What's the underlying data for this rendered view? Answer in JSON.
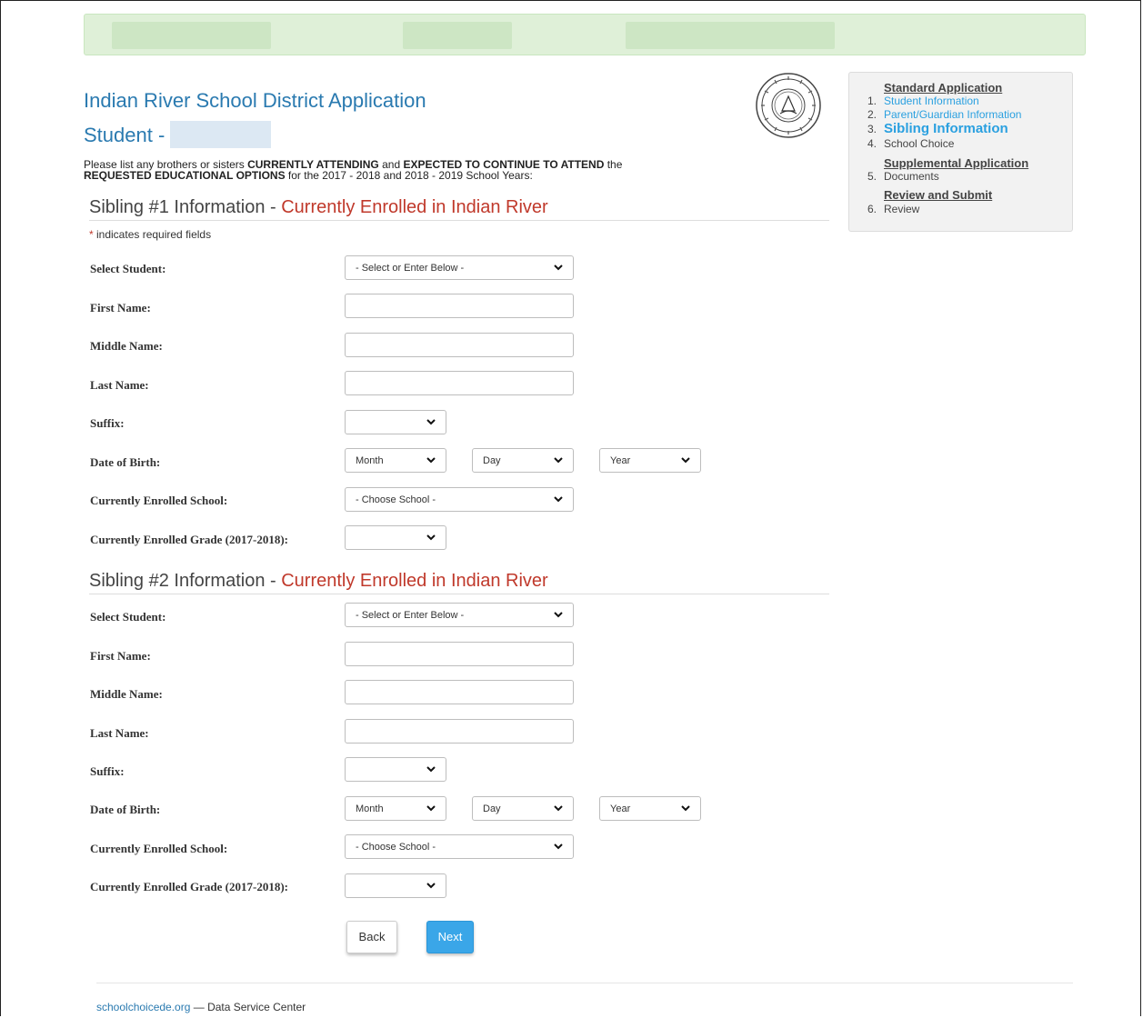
{
  "header": {
    "title": "Indian River School District Application",
    "student_prefix": "Student -"
  },
  "intro": {
    "part1": "Please list any brothers or sisters ",
    "strong1": "CURRENTLY ATTENDING",
    "part2": " and ",
    "strong2": "EXPECTED TO CONTINUE TO ATTEND",
    "part3": " the",
    "strong3": "REQUESTED EDUCATIONAL OPTIONS",
    "part4": " for the 2017 - 2018 and 2018 - 2019 School Years:"
  },
  "required_note": {
    "star": "*",
    "text": " indicates required fields"
  },
  "siblings": [
    {
      "heading": "Sibling #1 Information - ",
      "status": "Currently Enrolled in Indian River",
      "labels": {
        "select_student": "Select Student:",
        "first_name": "First Name:",
        "middle_name": "Middle Name:",
        "last_name": "Last Name:",
        "suffix": "Suffix:",
        "dob": "Date of Birth:",
        "school": "Currently Enrolled School:",
        "grade": "Currently Enrolled Grade (2017-2018):"
      },
      "values": {
        "select_student": "- Select or Enter Below -",
        "first_name": "",
        "middle_name": "",
        "last_name": "",
        "suffix": "",
        "month": "Month",
        "day": "Day",
        "year": "Year",
        "school": "- Choose School -",
        "grade": ""
      }
    },
    {
      "heading": "Sibling #2 Information - ",
      "status": "Currently Enrolled in Indian River",
      "labels": {
        "select_student": "Select Student:",
        "first_name": "First Name:",
        "middle_name": "Middle Name:",
        "last_name": "Last Name:",
        "suffix": "Suffix:",
        "dob": "Date of Birth:",
        "school": "Currently Enrolled School:",
        "grade": "Currently Enrolled Grade (2017-2018):"
      },
      "values": {
        "select_student": "- Select or Enter Below -",
        "first_name": "",
        "middle_name": "",
        "last_name": "",
        "suffix": "",
        "month": "Month",
        "day": "Day",
        "year": "Year",
        "school": "- Choose School -",
        "grade": ""
      }
    }
  ],
  "buttons": {
    "back": "Back",
    "next": "Next"
  },
  "sidebar": {
    "standard_heading": "Standard Application",
    "items": [
      {
        "num": "1.",
        "label": "Student Information"
      },
      {
        "num": "2.",
        "label": "Parent/Guardian Information"
      },
      {
        "num": "3.",
        "label": "Sibling Information"
      },
      {
        "num": "4.",
        "label": "School Choice"
      },
      {
        "num": "5.",
        "label": "Documents"
      },
      {
        "num": "6.",
        "label": "Review"
      }
    ],
    "supplemental_heading": "Supplemental Application",
    "review_heading": "Review and Submit"
  },
  "footer": {
    "link": "schoolchoicede.org",
    "text": " — Data Service Center"
  },
  "colors": {
    "title_blue": "#2a7ab0",
    "status_red": "#c0392b",
    "next_button": "#3aa6e8",
    "banner_green": "#dff0d8"
  }
}
